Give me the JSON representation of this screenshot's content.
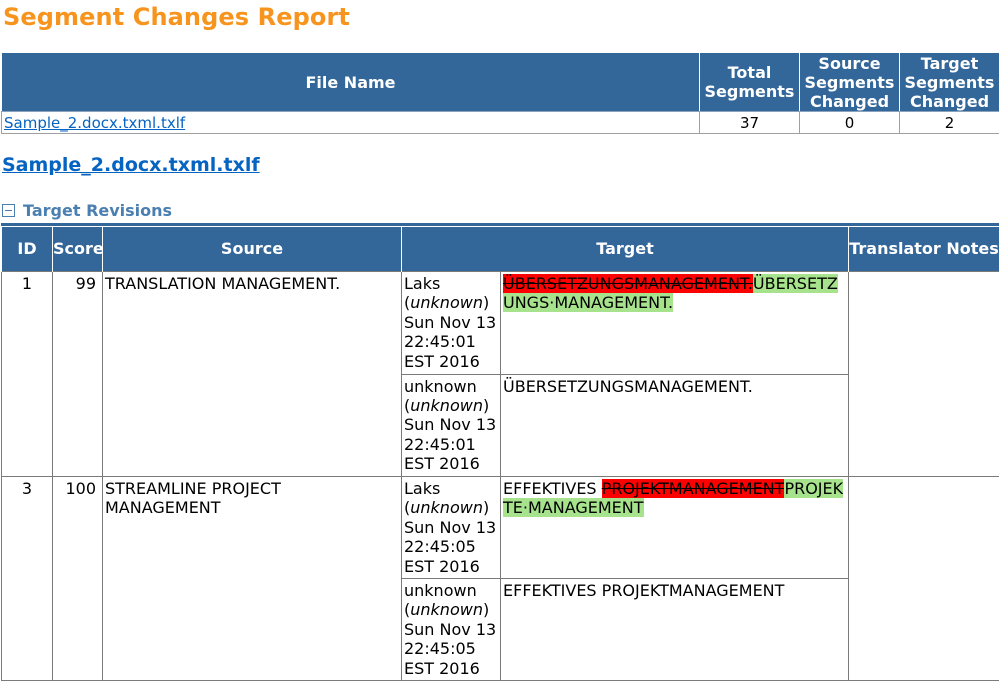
{
  "report": {
    "title": "Segment Changes Report"
  },
  "summary": {
    "headers": {
      "file_name": "File Name",
      "total_segments": "Total Segments",
      "source_changed": "Source Segments Changed",
      "target_changed": "Target Segments Changed"
    },
    "row": {
      "file_name": "Sample_2.docx.txml.txlf",
      "total": "37",
      "source_changed": "0",
      "target_changed": "2"
    }
  },
  "file_heading": "Sample_2.docx.txml.txlf",
  "section": {
    "title": "Target Revisions"
  },
  "revisions": {
    "headers": {
      "id": "ID",
      "score": "Score",
      "source": "Source",
      "target": "Target",
      "notes": "Translator Notes"
    },
    "rows": [
      {
        "id": "1",
        "score": "99",
        "source": "TRANSLATION MANAGEMENT.",
        "notes": "",
        "revisions": [
          {
            "author": "Laks",
            "status": "unknown",
            "date": "Sun Nov 13 22:45:01 EST 2016",
            "target_prefix": "",
            "deleted": "ÜBERSETZUNGSMANAGEMENT.",
            "inserted": "ÜBERSETZUNGS·MANAGEMENT."
          },
          {
            "author": "unknown",
            "status": "unknown",
            "date": "Sun Nov 13 22:45:01 EST 2016",
            "target": "ÜBERSETZUNGSMANAGEMENT."
          }
        ]
      },
      {
        "id": "3",
        "score": "100",
        "source": "STREAMLINE PROJECT MANAGEMENT",
        "notes": "",
        "revisions": [
          {
            "author": "Laks",
            "status": "unknown",
            "date": "Sun Nov 13 22:45:05 EST 2016",
            "target_prefix": "EFFEKTIVES",
            "deleted": "PROJEKTMANAGEMENT",
            "inserted": "PROJEKTE·MANAGEMENT"
          },
          {
            "author": "unknown",
            "status": "unknown",
            "date": "Sun Nov 13 22:45:05 EST 2016",
            "target": "EFFEKTIVES PROJEKTMANAGEMENT"
          }
        ]
      }
    ]
  }
}
